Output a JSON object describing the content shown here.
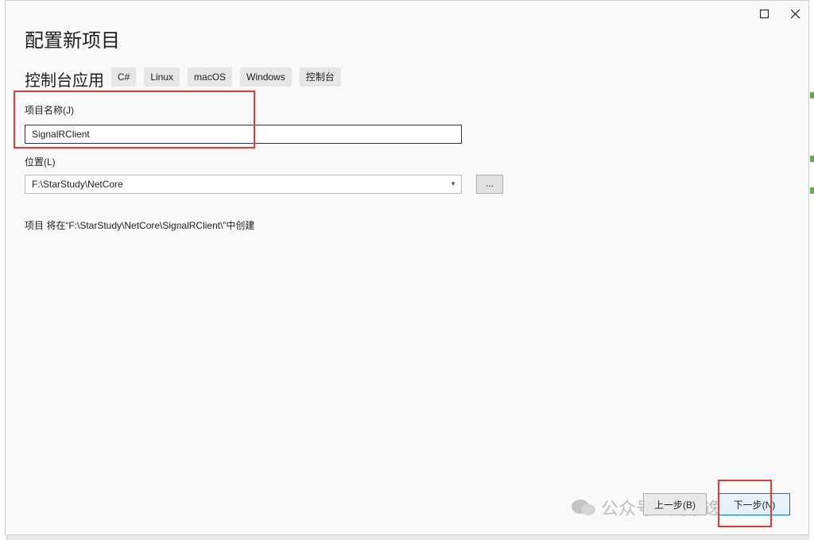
{
  "dialog": {
    "title": "配置新项目",
    "template_name": "控制台应用",
    "tags": [
      "C#",
      "Linux",
      "macOS",
      "Windows",
      "控制台"
    ]
  },
  "project_name": {
    "label": "项目名称(J)",
    "value": "SignalRClient"
  },
  "location": {
    "label": "位置(L)",
    "value": "F:\\StarStudy\\NetCore",
    "browse_label": "..."
  },
  "path_note": "项目 将在“F:\\StarStudy\\NetCore\\SignalRClient\\”中创建",
  "buttons": {
    "back": "上一步(B)",
    "next": "下一步(N)"
  },
  "watermark": "公众号 · 武穆逸仙",
  "colors": {
    "highlight": "#e53935",
    "primary_border": "#0078d7"
  },
  "icons": {
    "maximize": "maximize-icon",
    "close": "close-icon",
    "dropdown": "chevron-down-icon",
    "wechat": "wechat-icon"
  }
}
